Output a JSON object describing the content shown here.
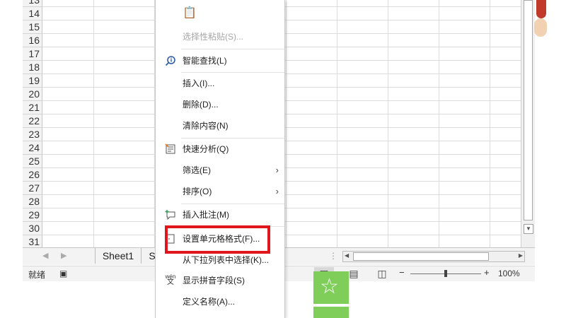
{
  "rows": [
    "13",
    "14",
    "15",
    "16",
    "17",
    "18",
    "19",
    "20",
    "21",
    "22",
    "23",
    "24",
    "25",
    "26",
    "27",
    "28",
    "29",
    "30",
    "31"
  ],
  "context_menu": {
    "paste_special": "选择性粘贴(S)...",
    "smart_lookup": "智能查找(L)",
    "insert": "插入(I)...",
    "delete": "删除(D)...",
    "clear_contents": "清除内容(N)",
    "quick_analysis": "快速分析(Q)",
    "filter": "筛选(E)",
    "sort": "排序(O)",
    "insert_comment": "插入批注(M)",
    "format_cells": "设置单元格格式(F)...",
    "pick_from_list": "从下拉列表中选择(K)...",
    "show_phonetic": "显示拼音字段(S)",
    "define_name": "定义名称(A)...",
    "submenu_arrow": "›",
    "phonetic_icon_text": "wén"
  },
  "sheet_tabs": {
    "active": "Sheet1",
    "partial": "S"
  },
  "status": {
    "ready": "就绪",
    "zoom": "100%",
    "minus": "−",
    "plus": "+"
  },
  "colors": {
    "highlight": "#e0161c",
    "accent_green": "#7fce5a"
  }
}
